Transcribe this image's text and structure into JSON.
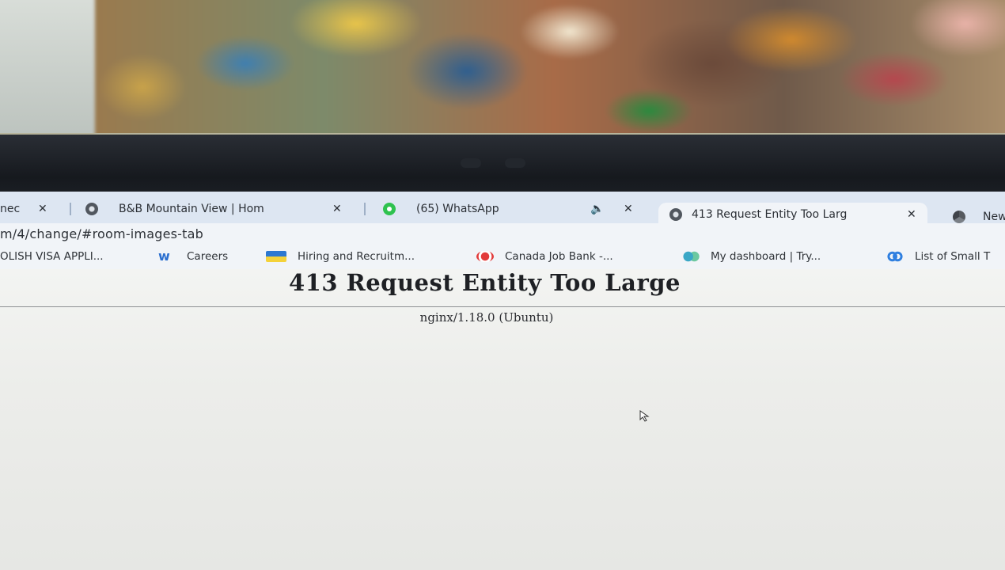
{
  "browser": {
    "tabs": [
      {
        "label": "nec",
        "close": "✕",
        "icon": "globe-icon",
        "active": false
      },
      {
        "label": "B&B Mountain View | Hom",
        "close": "✕",
        "icon": "globe-icon",
        "active": false
      },
      {
        "label": "(65) WhatsApp",
        "close": "✕",
        "icon": "whatsapp-icon",
        "audio_icon": "speaker-icon",
        "active": false
      },
      {
        "label": "413 Request Entity Too Larg",
        "close": "✕",
        "icon": "globe-icon",
        "active": true
      },
      {
        "label": "New",
        "icon": "chrome-icon",
        "active": false
      }
    ],
    "address_bar": {
      "url": "m/4/change/#room-images-tab"
    },
    "bookmarks": [
      {
        "label": "OLISH VISA APPLI...",
        "icon": ""
      },
      {
        "label": "Careers",
        "icon": "workday-icon"
      },
      {
        "label": "Hiring and Recruitm...",
        "icon": "ukraine-flag-icon"
      },
      {
        "label": "Canada Job Bank -...",
        "icon": "canada-flag-icon"
      },
      {
        "label": "My dashboard | Try...",
        "icon": "dashboard-icon"
      },
      {
        "label": "List of Small T",
        "icon": "link-icon"
      }
    ]
  },
  "page": {
    "heading": "413 Request Entity Too Large",
    "server": "nginx/1.18.0 (Ubuntu)"
  }
}
